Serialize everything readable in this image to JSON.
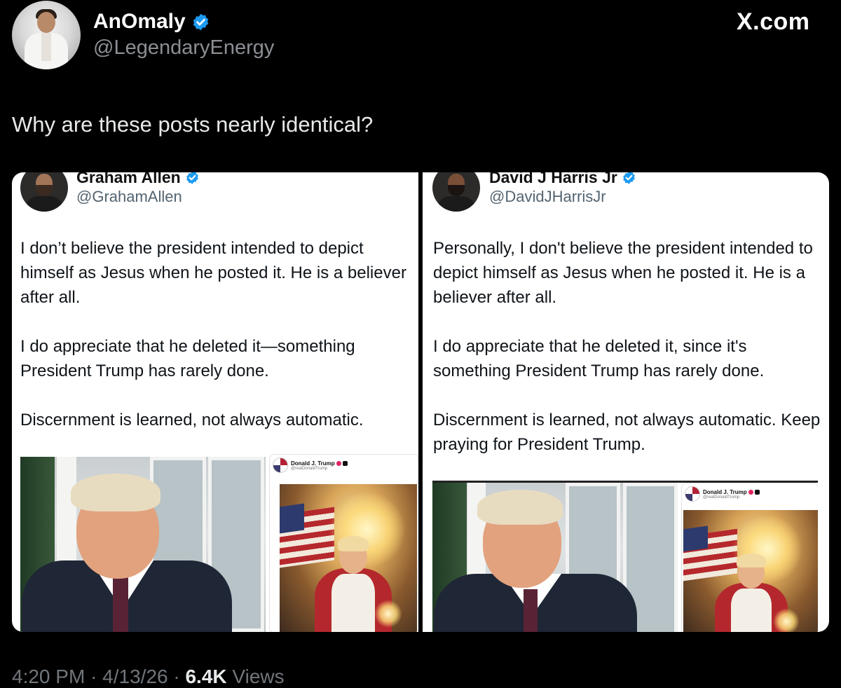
{
  "outer_post": {
    "author_name": "AnOmaly",
    "author_handle": "@LegendaryEnergy",
    "brand": "X.com",
    "text": "Why are these posts nearly identical?",
    "footer": {
      "time": "4:20 PM",
      "separator": "·",
      "date": "4/13/26",
      "views_count": "6.4K",
      "views_label": "Views"
    }
  },
  "quoted_left": {
    "name": "Graham Allen",
    "handle": "@GrahamAllen",
    "paragraphs": [
      "I don’t believe the president intended to depict himself as Jesus when he posted it. He is a believer after all.",
      "I do appreciate that he deleted it—something President Trump has rarely done.",
      "Discernment is learned, not always automatic."
    ],
    "embed": {
      "name": "Donald J. Trump",
      "handle": "@realDonaldTrump"
    }
  },
  "quoted_right": {
    "name": "David J Harris Jr",
    "handle": "@DavidJHarrisJr",
    "paragraphs": [
      "Personally, I don't believe the president intended to depict himself as Jesus when he posted it. He is a believer after all.",
      "I do appreciate that he deleted it, since it's something President Trump has rarely done.",
      "Discernment is learned, not always automatic. Keep praying for President Trump."
    ],
    "embed": {
      "name": "Donald J. Trump",
      "handle": "@realDonaldTrump"
    }
  },
  "colors": {
    "background": "#000000",
    "verified_blue": "#1d9bf0",
    "panel_bg": "#ffffff",
    "muted_text": "#71767b"
  },
  "icons": [
    "verified-badge-icon",
    "x-logo-icon"
  ]
}
